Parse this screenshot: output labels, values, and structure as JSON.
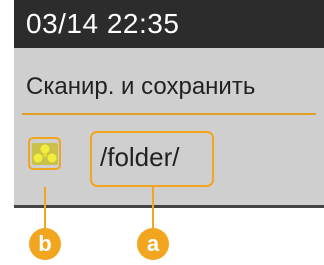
{
  "status_bar": {
    "datetime": "03/14 22:35"
  },
  "screen": {
    "title": "Сканир. и сохранить",
    "destination_path": "/folder/",
    "folder_icon": "shared-folder-icon"
  },
  "callouts": {
    "a": "a",
    "b": "b"
  },
  "colors": {
    "accent": "#f2a51e",
    "status_bar_bg": "#2c2c2c",
    "screen_bg": "#cfcfcf"
  }
}
